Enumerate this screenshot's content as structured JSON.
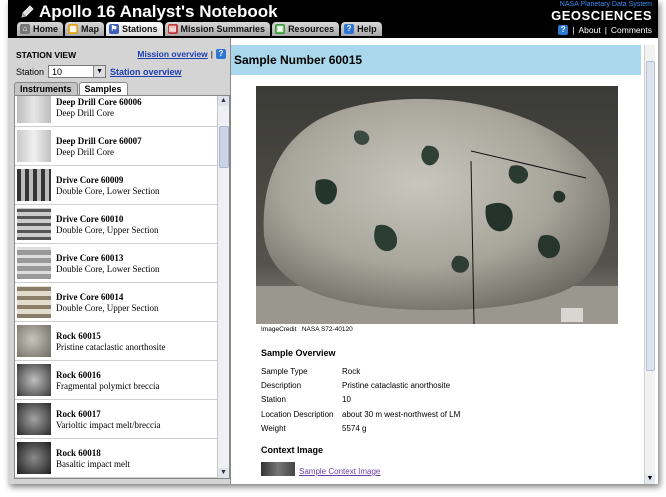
{
  "app": {
    "title": "Apollo 16 Analyst's Notebook"
  },
  "nav": {
    "tabs": [
      {
        "label": "Home",
        "icon": "home-icon",
        "color": "#777777"
      },
      {
        "label": "Map",
        "icon": "map-icon",
        "color": "#e3a01b"
      },
      {
        "label": "Stations",
        "icon": "flag-icon",
        "color": "#3b5fb8",
        "active": true
      },
      {
        "label": "Mission Summaries",
        "icon": "document-icon",
        "color": "#c23a3a"
      },
      {
        "label": "Resources",
        "icon": "folder-icon",
        "color": "#3a9d3a"
      },
      {
        "label": "Help",
        "icon": "help-icon",
        "color": "#2d77d3"
      }
    ]
  },
  "brand": {
    "small": "NASA Planetary Data System",
    "big": "GEOSCIENCES",
    "about": "About",
    "comments": "Comments",
    "sep1": "|",
    "sep2": "|"
  },
  "station_view": {
    "title": "STATION VIEW",
    "mission_overview": "Mission overview",
    "separator": "|",
    "station_label": "Station",
    "station_value": "10",
    "station_overview": "Station overview",
    "subtabs": [
      "Instruments",
      "Samples"
    ],
    "active_subtab": "Samples"
  },
  "samples": [
    {
      "name": "Deep Drill Core 60006",
      "desc": "Deep Drill Core"
    },
    {
      "name": "Deep Drill Core 60007",
      "desc": "Deep Drill Core"
    },
    {
      "name": "Drive Core 60009",
      "desc": "Double Core, Lower Section"
    },
    {
      "name": "Drive Core 60010",
      "desc": "Double Core, Upper Section"
    },
    {
      "name": "Drive Core 60013",
      "desc": "Double Core, Lower Section"
    },
    {
      "name": "Drive Core 60014",
      "desc": "Double Core, Upper Section"
    },
    {
      "name": "Rock 60015",
      "desc": "Pristine cataclastic anorthosite"
    },
    {
      "name": "Rock 60016",
      "desc": "Fragmental polymict breccia"
    },
    {
      "name": "Rock 60017",
      "desc": "Varioltic impact melt/breccia"
    },
    {
      "name": "Rock 60018",
      "desc": "Basaltic impact melt"
    }
  ],
  "detail": {
    "title": "Sample Number 60015",
    "image_credit_label": "ImageCredit",
    "image_credit_value": "NASA S72-40120",
    "overview_title": "Sample Overview",
    "properties": [
      {
        "label": "Sample Type",
        "value": "Rock"
      },
      {
        "label": "Description",
        "value": "Pristine cataclastic anorthosite"
      },
      {
        "label": "Station",
        "value": "10"
      },
      {
        "label": "Location Description",
        "value": "about 30 m west-northwest of LM"
      },
      {
        "label": "Weight",
        "value": "5574 g"
      }
    ],
    "context_title": "Context Image",
    "context_link": "Sample Context Image"
  }
}
